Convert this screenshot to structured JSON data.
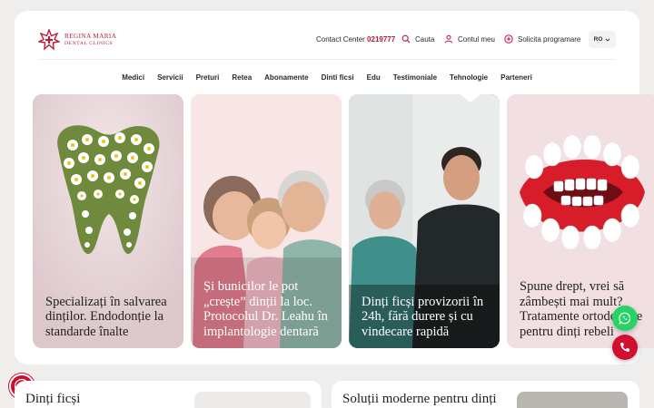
{
  "brand": {
    "line1": "REGINA MARIA",
    "line2": "DENTAL CLINICS",
    "color": "#b81b3b"
  },
  "topbar": {
    "contact_label": "Contact Center",
    "contact_number": "0219777",
    "search_label": "Cauta",
    "account_label": "Contul meu",
    "appointment_label": "Solicita programare",
    "language": "RO"
  },
  "nav": {
    "items": [
      "Medici",
      "Servicii",
      "Preturi",
      "Retea",
      "Abonamente",
      "Dinti ficsi",
      "Edu",
      "Testimoniale",
      "Tehnologie",
      "Parteneri"
    ]
  },
  "cards": [
    {
      "title": "Specializați în salvarea dinților. Endodonție la standarde înalte",
      "bg": "#e9d9dc"
    },
    {
      "title": "Și bunicilor le pot „crește” dinții la loc. Protocolul Dr. Leahu în implantologie dentară",
      "bg": "#f7e3e4"
    },
    {
      "title": "Dinți ficși provizorii în 24h, fără durere și cu vindecare rapidă",
      "bg": "#2a3a38"
    },
    {
      "title": "Spune drept, vrei să zâmbești mai mult? Tratamente ortodontice pentru dinți rebeli",
      "bg": "#f0dcdf"
    }
  ],
  "bottom": {
    "left_title": "Dinți ficși",
    "right_title": "Soluții moderne pentru dinți"
  },
  "colors": {
    "accent": "#b81b3b",
    "whatsapp": "#25d366",
    "call": "#d0102e"
  },
  "icons": [
    "logo-icon",
    "search-icon",
    "user-icon",
    "plus-circle-icon",
    "chevron-down-icon",
    "whatsapp-icon",
    "phone-icon",
    "accessibility-icon"
  ]
}
